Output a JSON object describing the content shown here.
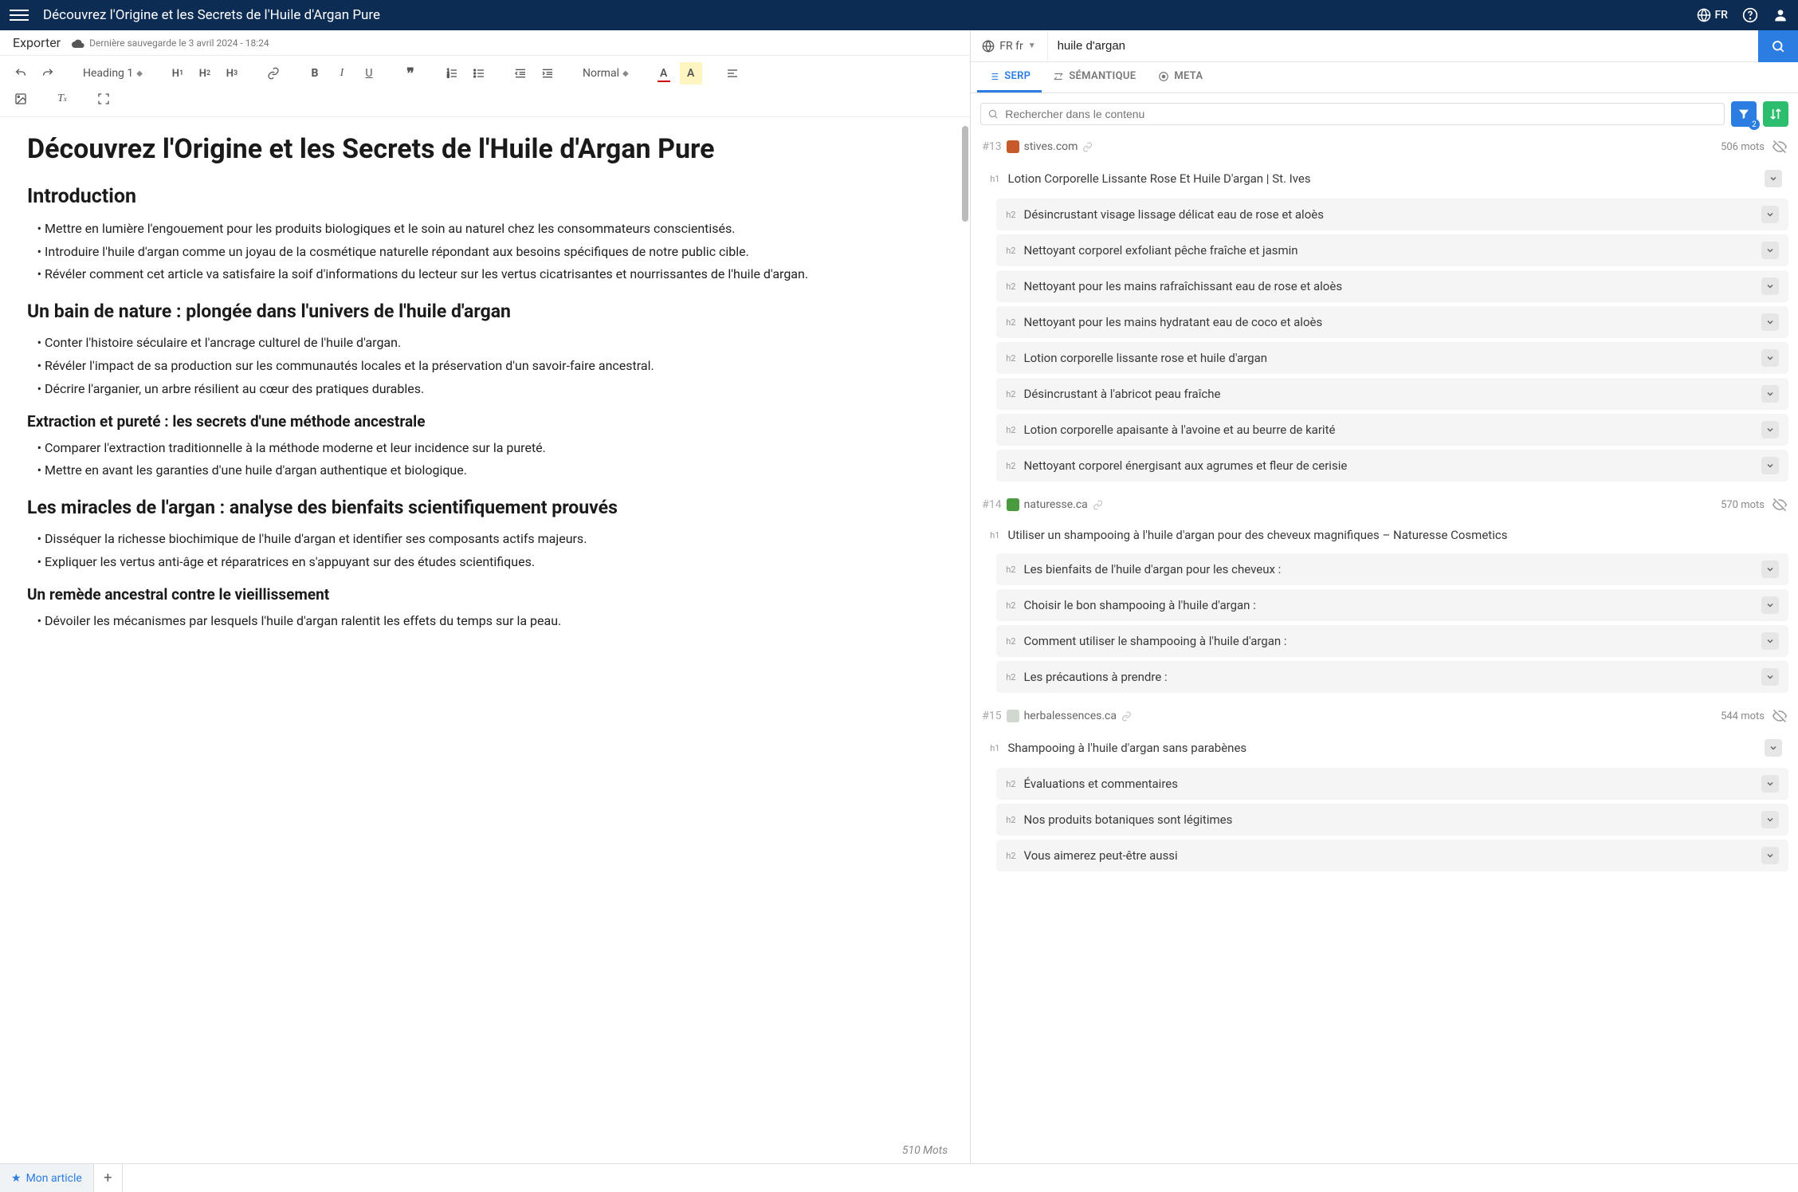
{
  "topbar": {
    "title": "Découvrez l'Origine et les Secrets de l'Huile d'Argan Pure",
    "lang": "FR"
  },
  "export": {
    "label": "Exporter",
    "save_status": "Dernière sauvegarde le 3 avril 2024 - 18:24"
  },
  "toolbar": {
    "heading_select": "Heading 1",
    "size_select": "Normal"
  },
  "article": {
    "h1": "Découvrez l'Origine et les Secrets de l'Huile d'Argan Pure",
    "sections": [
      {
        "type": "h2",
        "text": "Introduction"
      },
      {
        "type": "ul",
        "items": [
          "Mettre en lumière l'engouement pour les produits biologiques et le soin au naturel chez les consommateurs conscientisés.",
          "Introduire l'huile d'argan comme un joyau de la cosmétique naturelle répondant aux besoins spécifiques de notre public cible.",
          "Révéler comment cet article va satisfaire la soif d'informations du lecteur sur les vertus cicatrisantes et nourrissantes de l'huile d'argan."
        ]
      },
      {
        "type": "h2a",
        "text": "Un bain de nature : plongée dans l'univers de l'huile d'argan"
      },
      {
        "type": "ul",
        "items": [
          "Conter l'histoire séculaire et l'ancrage culturel de l'huile d'argan.",
          "Révéler l'impact de sa production sur les communautés locales et la préservation d'un savoir-faire ancestral.",
          "Décrire l'arganier, un arbre résilient au cœur des pratiques durables."
        ]
      },
      {
        "type": "h3",
        "text": "Extraction et pureté : les secrets d'une méthode ancestrale"
      },
      {
        "type": "ul",
        "items": [
          "Comparer l'extraction traditionnelle à la méthode moderne et leur incidence sur la pureté.",
          "Mettre en avant les garanties d'une huile d'argan authentique et biologique."
        ]
      },
      {
        "type": "h2a",
        "text": "Les miracles de l'argan : analyse des bienfaits scientifiquement prouvés"
      },
      {
        "type": "ul",
        "items": [
          "Disséquer la richesse biochimique de l'huile d'argan et identifier ses composants actifs majeurs.",
          "Expliquer les vertus anti-âge et réparatrices en s'appuyant sur des études scientifiques."
        ]
      },
      {
        "type": "h3",
        "text": "Un remède ancestral contre le vieillissement"
      },
      {
        "type": "ul",
        "items": [
          "Dévoiler les mécanismes par lesquels l'huile d'argan ralentit les effets du temps sur la peau."
        ]
      }
    ],
    "wordcount": "510 Mots"
  },
  "right": {
    "locale": "FR fr",
    "query": "huile d'argan",
    "tabs": {
      "serp": "SERP",
      "semantique": "SÉMANTIQUE",
      "meta": "META"
    },
    "filter_placeholder": "Rechercher dans le contenu",
    "filter_badge": "2",
    "results": [
      {
        "rank": "#13",
        "domain": "stives.com",
        "favicon_bg": "#c65a2c",
        "words": "506 mots",
        "headings": [
          {
            "tag": "h1",
            "text": "Lotion Corporelle Lissante Rose Et Huile D'argan | St. Ives",
            "expand": true
          },
          {
            "tag": "h2",
            "text": "Désincrustant visage lissage délicat eau de rose et aloès",
            "expand": true
          },
          {
            "tag": "h2",
            "text": "Nettoyant corporel exfoliant pêche fraîche et jasmin",
            "expand": true
          },
          {
            "tag": "h2",
            "text": "Nettoyant pour les mains rafraîchissant eau de rose et aloès",
            "expand": true
          },
          {
            "tag": "h2",
            "text": "Nettoyant pour les mains hydratant eau de coco et aloès",
            "expand": true
          },
          {
            "tag": "h2",
            "text": "Lotion corporelle lissante rose et huile d'argan",
            "expand": true
          },
          {
            "tag": "h2",
            "text": "Désincrustant à l'abricot peau fraîche",
            "expand": true
          },
          {
            "tag": "h2",
            "text": "Lotion corporelle apaisante à l'avoine et au beurre de karité",
            "expand": true
          },
          {
            "tag": "h2",
            "text": "Nettoyant corporel énergisant aux agrumes et fleur de cerisie",
            "expand": true
          }
        ]
      },
      {
        "rank": "#14",
        "domain": "naturesse.ca",
        "favicon_bg": "#4a9a3f",
        "words": "570 mots",
        "headings": [
          {
            "tag": "h1",
            "text": "Utiliser un shampooing à l'huile d'argan pour des cheveux magnifiques – Naturesse Cosmetics",
            "expand": false
          },
          {
            "tag": "h2",
            "text": "Les bienfaits de l'huile d'argan pour les cheveux :",
            "expand": true
          },
          {
            "tag": "h2",
            "text": "Choisir le bon shampooing à l'huile d'argan :",
            "expand": true
          },
          {
            "tag": "h2",
            "text": "Comment utiliser le shampooing à l'huile d'argan :",
            "expand": true
          },
          {
            "tag": "h2",
            "text": "Les précautions à prendre :",
            "expand": true
          }
        ]
      },
      {
        "rank": "#15",
        "domain": "herbalessences.ca",
        "favicon_bg": "#d0d8d0",
        "words": "544 mots",
        "headings": [
          {
            "tag": "h1",
            "text": "Shampooing à l'huile d'argan sans parabènes",
            "expand": true
          },
          {
            "tag": "h2",
            "text": "Évaluations et commentaires",
            "expand": true
          },
          {
            "tag": "h2",
            "text": "Nos produits botaniques sont légitimes",
            "expand": true
          },
          {
            "tag": "h2",
            "text": "Vous aimerez peut-être aussi",
            "expand": true
          }
        ]
      }
    ]
  },
  "bottom": {
    "tab_label": "Mon article"
  }
}
